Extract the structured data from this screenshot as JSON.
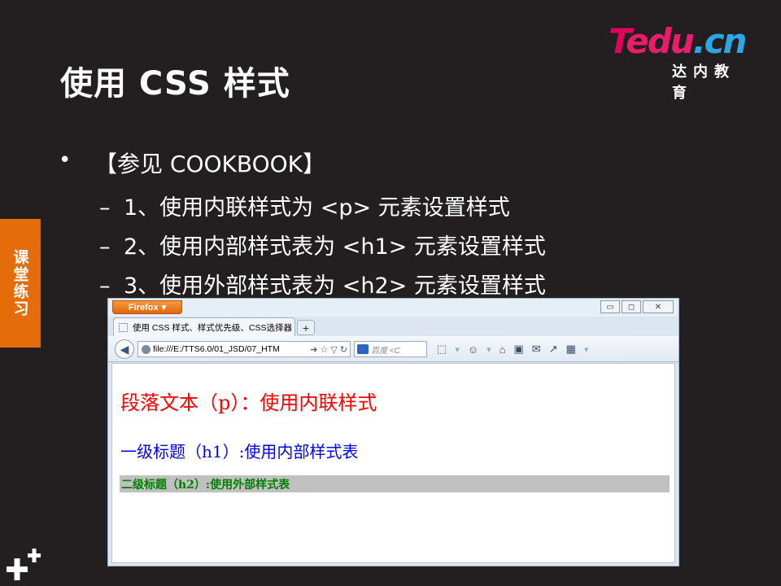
{
  "slide": {
    "title": "使用 CSS 样式",
    "logo_text": {
      "t": "T",
      "edu": "edu",
      "dot_cn": ".cn"
    },
    "logo_sub": "达内教育",
    "side_tab": "课堂练习",
    "bullet": "【参见 COOKBOOK】",
    "sub_items": [
      "1、使用内联样式为 <p> 元素设置样式",
      "2、使用内部样式表为 <h1> 元素设置样式",
      "3、使用外部样式表为 <h2> 元素设置样式"
    ]
  },
  "browser": {
    "firefox_button": "Firefox",
    "tab_title": "使用 CSS 样式、样式优先级、CSS选择器",
    "new_tab": "+",
    "url": "file:///E:/TTS6.0/01_JSD/07_HTM",
    "search_placeholder": "百度 <C",
    "window_controls": {
      "minimize": "▭",
      "restore": "◻",
      "close": "✕"
    }
  },
  "page_content": {
    "p_text": "段落文本（p）：使用内联样式",
    "h1_text": "一级标题（h1）:使用内部样式表",
    "h2_text": "二级标题（h2）:使用外部样式表"
  },
  "colors": {
    "background": "#231f20",
    "side_tab": "#e46c0a",
    "p_color": "#ff0000",
    "h1_color": "#0000ff",
    "h2_color": "#008000",
    "h2_background": "#c0c0c0"
  },
  "icons": [
    "back-arrow-icon",
    "page-info-icon",
    "bookmark-star-icon",
    "reload-icon",
    "search-engine-icon",
    "home-icon",
    "bookmarks-icon",
    "downloads-icon",
    "addons-icon"
  ]
}
